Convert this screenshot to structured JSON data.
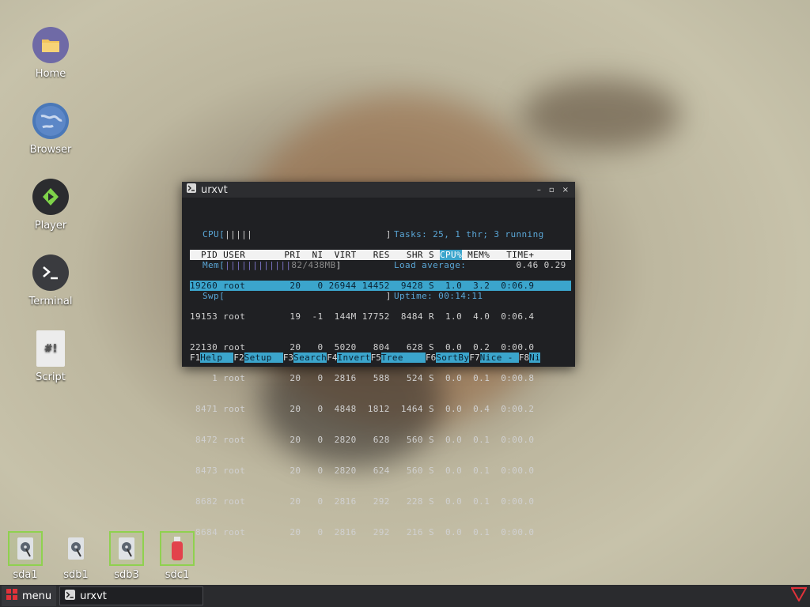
{
  "desktop": {
    "icons": [
      {
        "label": "Home",
        "icon": "folder-icon"
      },
      {
        "label": "Browser",
        "icon": "globe-icon"
      },
      {
        "label": "Player",
        "icon": "play-icon"
      },
      {
        "label": "Terminal",
        "icon": "terminal-icon"
      },
      {
        "label": "Script",
        "icon": "script-file-icon"
      }
    ],
    "drives": [
      {
        "label": "sda1",
        "icon": "hard-disk-icon",
        "selected": true
      },
      {
        "label": "sdb1",
        "icon": "hard-disk-icon",
        "selected": false
      },
      {
        "label": "sdb3",
        "icon": "hard-disk-icon",
        "selected": true
      },
      {
        "label": "sdc1",
        "icon": "usb-drive-icon",
        "selected": true
      }
    ]
  },
  "window": {
    "title": "urxvt",
    "controls": [
      "–",
      "▫",
      "×"
    ]
  },
  "htop": {
    "cpu_label": "CPU[",
    "cpu_bar": "|||||",
    "cpu_end": "                        ]",
    "mem_label": "Mem[",
    "mem_bar": "||||||||||||",
    "mem_value": "82/438MB",
    "mem_end": "]",
    "swp_label": "Swp[",
    "swp_end": "                             ]",
    "tasks": "Tasks: 25, 1 thr; 3 running",
    "load_label": "Load average:",
    "load_values": "0.46 0.29",
    "uptime": "Uptime: 00:14:11",
    "header_a": "  PID USER       PRI  NI  VIRT   RES   SHR S ",
    "header_cpu": "CPU%",
    "header_b": " MEM%   TIME+",
    "rows": [
      "19260 root        20   0 26944 14452  9428 S  1.0  3.2  0:06.9",
      "19153 root        19  -1  144M 17752  8484 R  1.0  4.0  0:06.4",
      "22130 root        20   0  5020   804   628 S  0.0  0.2  0:00.0",
      "    1 root        20   0  2816   588   524 S  0.0  0.1  0:00.8",
      " 8471 root        20   0  4848  1812  1464 S  0.0  0.4  0:00.2",
      " 8472 root        20   0  2820   628   560 S  0.0  0.1  0:00.0",
      " 8473 root        20   0  2820   624   560 S  0.0  0.1  0:00.0",
      " 8682 root        20   0  2816   292   228 S  0.0  0.1  0:00.0",
      " 8684 root        20   0  2816   292   216 S  0.0  0.1  0:00.0"
    ],
    "fkeys": [
      {
        "key": "F1",
        "label": "Help  "
      },
      {
        "key": "F2",
        "label": "Setup  "
      },
      {
        "key": "F3",
        "label": "Search"
      },
      {
        "key": "F4",
        "label": "Invert"
      },
      {
        "key": "F5",
        "label": "Tree    "
      },
      {
        "key": "F6",
        "label": "SortBy"
      },
      {
        "key": "F7",
        "label": "Nice - "
      },
      {
        "key": "F8",
        "label": "Ni"
      }
    ]
  },
  "taskbar": {
    "menu_label": "menu",
    "task_label": "urxvt"
  },
  "colors": {
    "accent": "#3ba5cc",
    "selection_border": "#8fd14f"
  }
}
